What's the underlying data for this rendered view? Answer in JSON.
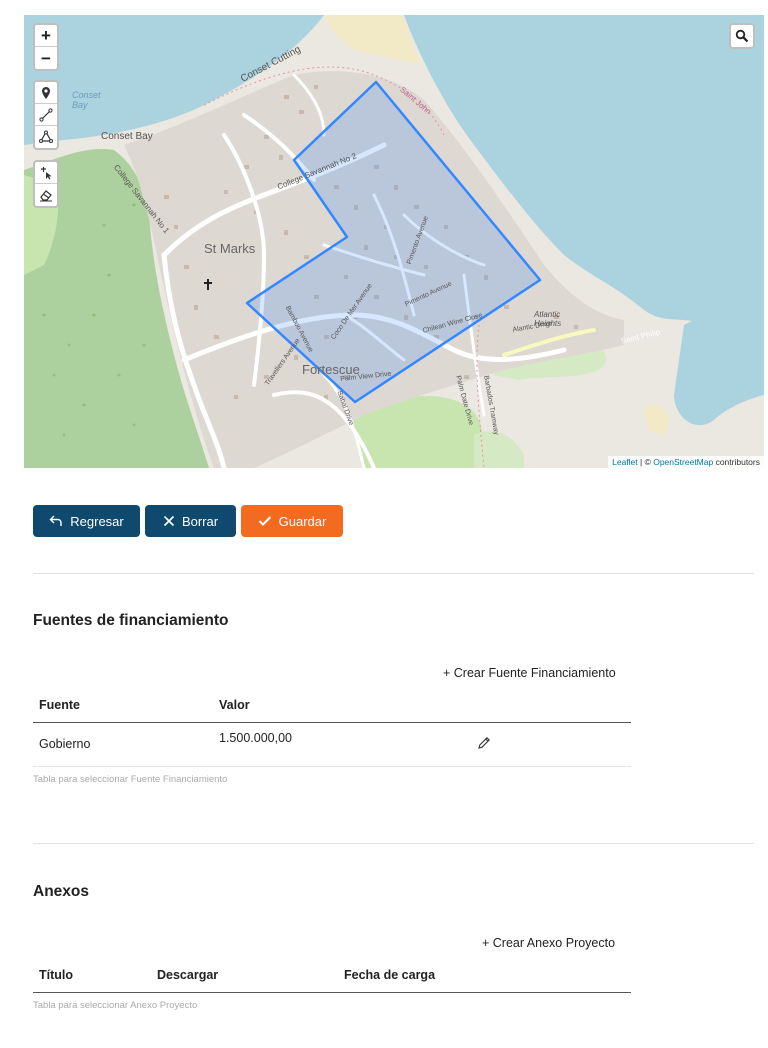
{
  "map": {
    "controls": {
      "zoom_in": "+",
      "zoom_out": "−"
    },
    "labels": {
      "conset_cutting": "Conset Cutting",
      "conset_bay_water": "Conset Bay",
      "conset_bay": "Conset Bay",
      "st_marks": "St Marks",
      "fortescue": "Fortescue",
      "college_savannah_no1": "College Savannah No 1",
      "college_savannah_no2": "College Savannah No 2",
      "saint_john": "Saint John",
      "atlantic_heights": "Atlantic Heights",
      "saint_philip": "Saint Philip",
      "pimento_avenue": "Pimento Avenue",
      "coco_de_mer": "Coco De Mer Avenue",
      "bamboo_avenue": "Bamboo Avenue",
      "chilean_wine": "Chilean Wine Close",
      "palm_view": "Palm View Drive",
      "alantic_drive": "Alantic Drive",
      "travellers": "Travellers Avenue",
      "sabal_drive": "Sabal Drive",
      "palm_date": "Palm Date Drive",
      "barbados_tramway": "Barbados Tramway"
    },
    "attribution": {
      "leaflet": "Leaflet",
      "separator": " | © ",
      "osm": "OpenStreetMap",
      "contributors": " contributors"
    },
    "colors": {
      "water": "#aad3df",
      "land": "#ebe7e1",
      "green": "#c8e5b0",
      "forest": "#add19e",
      "polygon": "#3388ff"
    }
  },
  "actions": {
    "back_label": "Regresar",
    "delete_label": "Borrar",
    "save_label": "Guardar"
  },
  "funding": {
    "title": "Fuentes de financiamiento",
    "create_label": "+ Crear Fuente Financiamiento",
    "columns": [
      "Fuente",
      "Valor"
    ],
    "rows": [
      {
        "fuente": "Gobierno",
        "valor": "1.500.000,00"
      }
    ],
    "caption": "Tabla para seleccionar Fuente Financiamiento"
  },
  "annexes": {
    "title": "Anexos",
    "create_label": "+ Crear Anexo Proyecto",
    "columns": [
      "Título",
      "Descargar",
      "Fecha de carga"
    ],
    "caption": "Tabla para seleccionar Anexo Proyecto"
  },
  "colors": {
    "primary": "#0f4a6e",
    "accent": "#f26b21"
  }
}
